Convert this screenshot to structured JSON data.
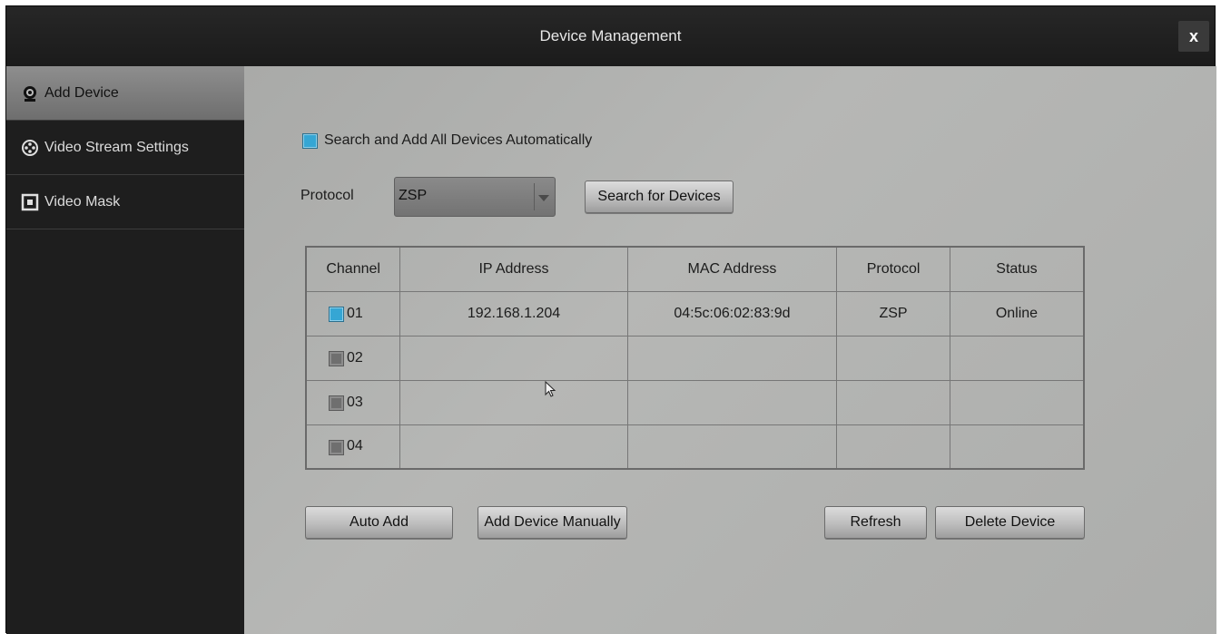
{
  "window": {
    "title": "Device Management",
    "close_label": "x"
  },
  "sidebar": {
    "items": [
      {
        "label": "Add Device",
        "icon": "webcam-icon",
        "active": true
      },
      {
        "label": "Video Stream Settings",
        "icon": "film-reel-icon",
        "active": false
      },
      {
        "label": "Video Mask",
        "icon": "mask-square-icon",
        "active": false
      }
    ]
  },
  "main": {
    "auto_search": {
      "label": "Search and Add All Devices Automatically",
      "checked": true
    },
    "protocol": {
      "label": "Protocol",
      "value": "ZSP"
    },
    "search_button": "Search for Devices",
    "table": {
      "headers": [
        "Channel",
        "IP Address",
        "MAC Address",
        "Protocol",
        "Status"
      ],
      "rows": [
        {
          "channel": "01",
          "checked": true,
          "ip": "192.168.1.204",
          "mac": "04:5c:06:02:83:9d",
          "protocol": "ZSP",
          "status": "Online"
        },
        {
          "channel": "02",
          "checked": false,
          "ip": "",
          "mac": "",
          "protocol": "",
          "status": ""
        },
        {
          "channel": "03",
          "checked": false,
          "ip": "",
          "mac": "",
          "protocol": "",
          "status": ""
        },
        {
          "channel": "04",
          "checked": false,
          "ip": "",
          "mac": "",
          "protocol": "",
          "status": ""
        }
      ]
    },
    "buttons": {
      "auto_add": "Auto Add",
      "add_manual": "Add Device Manually",
      "refresh": "Refresh",
      "delete": "Delete Device"
    }
  },
  "colors": {
    "accent": "#35a6d4",
    "titlebar": "#1b1b1b",
    "sidebar": "#1e1e1e",
    "panel": "#b0b1af"
  }
}
